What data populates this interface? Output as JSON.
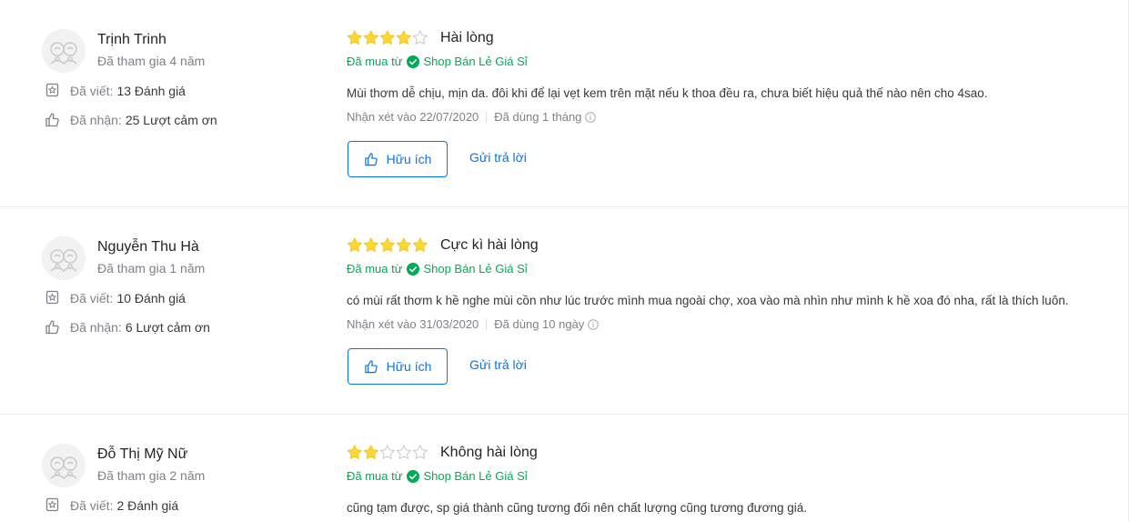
{
  "colors": {
    "accent": "#0b74e5",
    "star": "#fdd836",
    "green": "#00ab56",
    "muted": "#808089"
  },
  "icons": {
    "review_count": "review-count-icon",
    "thanks": "thumb-up-icon",
    "verified": "check-circle-icon",
    "info": "info-icon"
  },
  "reviews": [
    {
      "user": {
        "name": "Trịnh Trinh",
        "joined": "Đã tham gia 4 năm",
        "written_label": "Đã viết:",
        "written_value": "13 Đánh giá",
        "received_label": "Đã nhận:",
        "received_value": "25 Lượt cảm ơn"
      },
      "rating": 4,
      "title": "Hài lòng",
      "bought_from_label": "Đã mua từ",
      "shop": "Shop Bán Lẻ Giá Sỉ",
      "content": "Mùi thơm dễ chịu, mịn da. đôi khi để lại vẹt kem trên mặt nếu k thoa đều ra, chưa biết hiệu quả thế nào nên cho 4sao.",
      "review_date": "Nhận xét vào 22/07/2020",
      "used_for": "Đã dùng 1 tháng",
      "helpful_label": "Hữu ích",
      "reply_label": "Gửi trả lời"
    },
    {
      "user": {
        "name": "Nguyễn Thu Hà",
        "joined": "Đã tham gia 1 năm",
        "written_label": "Đã viết:",
        "written_value": "10 Đánh giá",
        "received_label": "Đã nhận:",
        "received_value": "6 Lượt cảm ơn"
      },
      "rating": 5,
      "title": "Cực kì hài lòng",
      "bought_from_label": "Đã mua từ",
      "shop": "Shop Bán Lẻ Giá Sỉ",
      "content": "có mùi rất thơm k hề nghe mùi cồn như lúc trước mình mua ngoài chợ, xoa vào mà nhìn như mình k hề xoa đó nha, rất là thích luôn.",
      "review_date": "Nhận xét vào 31/03/2020",
      "used_for": "Đã dùng 10 ngày",
      "helpful_label": "Hữu ích",
      "reply_label": "Gửi trả lời"
    },
    {
      "user": {
        "name": "Đỗ Thị Mỹ Nữ",
        "joined": "Đã tham gia 2 năm",
        "written_label": "Đã viết:",
        "written_value": "2 Đánh giá"
      },
      "rating": 2,
      "title": "Không hài lòng",
      "bought_from_label": "Đã mua từ",
      "shop": "Shop Bán Lẻ Giá Sỉ",
      "content": "cũng tạm được, sp giá thành cũng tương đối nên chất lượng cũng tương đương giá."
    }
  ]
}
